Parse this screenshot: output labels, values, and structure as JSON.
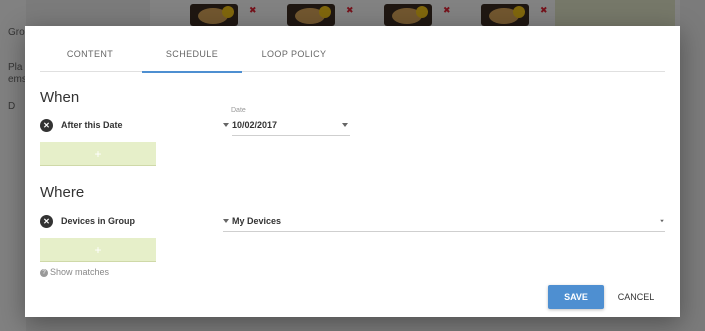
{
  "background": {
    "sidebar_rows": [
      "Gro",
      "Pla",
      "ems",
      "D"
    ]
  },
  "tabs": [
    {
      "label": "CONTENT"
    },
    {
      "label": "SCHEDULE"
    },
    {
      "label": "LOOP POLICY"
    }
  ],
  "active_tab": "SCHEDULE",
  "when": {
    "title": "When",
    "condition_label": "After this Date",
    "date_hint": "Date",
    "date_value": "10/02/2017",
    "add_label": "+"
  },
  "where": {
    "title": "Where",
    "condition_label": "Devices in Group",
    "group_value": "My Devices",
    "add_label": "+",
    "show_matches": "Show matches"
  },
  "actions": {
    "save": "SAVE",
    "cancel": "CANCEL"
  },
  "colors": {
    "accent": "#4e8fd1",
    "add_button": "#e6efc9"
  },
  "icons": [
    "remove-circle-icon",
    "caret-down-icon",
    "help-icon"
  ]
}
